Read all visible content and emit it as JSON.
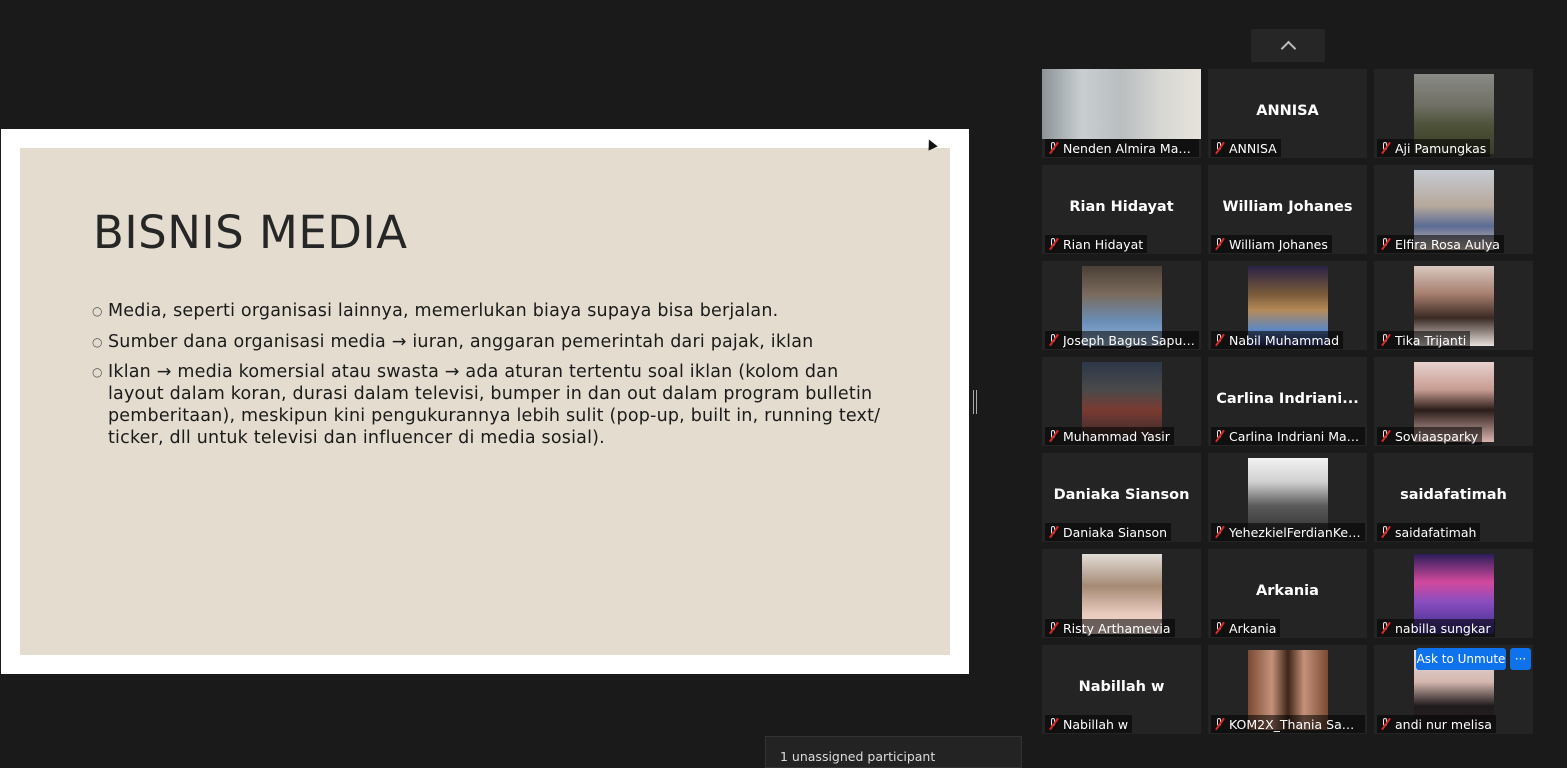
{
  "slide": {
    "title": "BISNIS MEDIA",
    "bullets": [
      "Media, seperti organisasi lainnya, memerlukan biaya supaya bisa berjalan.",
      "Sumber dana organisasi media → iuran, anggaran pemerintah dari pajak, iklan",
      "Iklan → media komersial atau swasta → ada aturan tertentu soal iklan (kolom dan layout dalam koran, durasi dalam televisi, bumper in dan out dalam program bulletin pemberitaan), meskipun kini pengukurannya lebih sulit (pop-up, built in, running text/ ticker, dll untuk televisi dan influencer di media sosial)."
    ],
    "bullet_symbol": "○"
  },
  "gallery": {
    "collapse_icon": "chevron-up-icon",
    "mic_icon": "mic-off-icon",
    "participants": [
      {
        "name": "Nenden Almira Mars...",
        "display": "",
        "video": "webcam-girl-glasses"
      },
      {
        "name": "ANNISA",
        "display": "ANNISA",
        "video": ""
      },
      {
        "name": "Aji Pamungkas",
        "display": "",
        "video": "photo-uniform"
      },
      {
        "name": "Rian Hidayat",
        "display": "Rian Hidayat",
        "video": ""
      },
      {
        "name": "William Johanes",
        "display": "William Johanes",
        "video": ""
      },
      {
        "name": "Elfira Rosa Aulya",
        "display": "",
        "video": "photo-group-monument"
      },
      {
        "name": "Joseph Bagus Saputra",
        "display": "",
        "video": "photo-man-blue-shirt"
      },
      {
        "name": "Nabil Muhammad",
        "display": "",
        "video": "photo-angel-wings"
      },
      {
        "name": "Tika Trijanti",
        "display": "",
        "video": "photo-woman-hair"
      },
      {
        "name": "Muhammad Yasir",
        "display": "",
        "video": "photo-man-jacket"
      },
      {
        "name": "Carlina Indriani Magd...",
        "display": "Carlina  Indriani...",
        "video": ""
      },
      {
        "name": "Soviaasparky",
        "display": "",
        "video": "photo-woman-selfie"
      },
      {
        "name": "Daniaka Sianson",
        "display": "Daniaka Sianson",
        "video": ""
      },
      {
        "name": "YehezkielFerdianKevin...",
        "display": "",
        "video": "photo-bw-man"
      },
      {
        "name": "saidafatimah",
        "display": "saidafatimah",
        "video": ""
      },
      {
        "name": "Risty Arthamevia",
        "display": "",
        "video": "photo-hijab"
      },
      {
        "name": "Arkania",
        "display": "Arkania",
        "video": ""
      },
      {
        "name": "nabilla sungkar",
        "display": "",
        "video": "photo-neon"
      },
      {
        "name": "Nabillah w",
        "display": "Nabillah w",
        "video": ""
      },
      {
        "name": "KOM2X_Thania Safiera",
        "display": "",
        "video": "photo-two-girls"
      },
      {
        "name": "andi nur melisa",
        "display": "",
        "video": "photo-girl-portrait"
      }
    ],
    "hover": {
      "ask_to_unmute": "Ask to Unmute",
      "more": "···"
    }
  },
  "footer": {
    "unassigned": "1 unassigned participant"
  }
}
